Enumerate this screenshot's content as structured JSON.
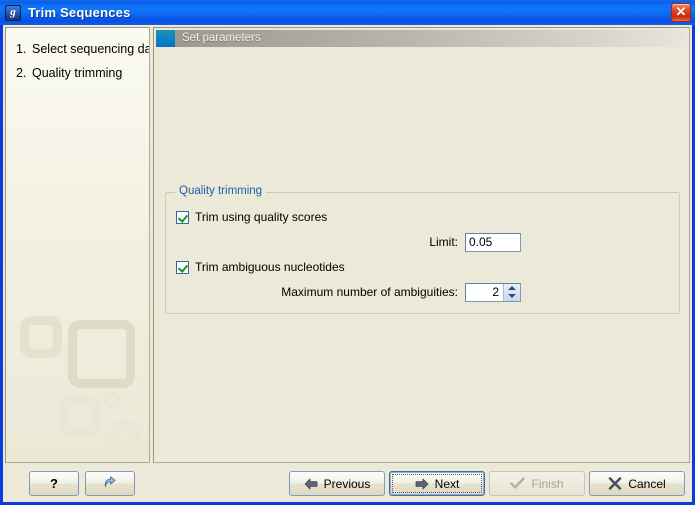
{
  "window": {
    "title": "Trim Sequences",
    "icon": "app-logo-icon",
    "close_label": "✕"
  },
  "sidebar": {
    "steps": [
      {
        "num": "1.",
        "label": "Select sequencing data"
      },
      {
        "num": "2.",
        "label": "Quality trimming"
      }
    ]
  },
  "main": {
    "header_title": "Set parameters",
    "groupbox": {
      "title": "Quality trimming",
      "trim_quality_checkbox": {
        "label": "Trim using quality scores",
        "checked": true
      },
      "limit_field": {
        "label": "Limit:",
        "value": "0.05"
      },
      "trim_ambiguous_checkbox": {
        "label": "Trim ambiguous nucleotides",
        "checked": true
      },
      "max_ambiguities": {
        "label": "Maximum number of ambiguities:",
        "value": "2"
      }
    }
  },
  "footer": {
    "help_label": "?",
    "reset_label": "",
    "previous_label": "Previous",
    "next_label": "Next",
    "finish_label": "Finish",
    "cancel_label": "Cancel"
  },
  "colors": {
    "titlebar_blue": "#0d6df4",
    "window_border": "#0a3ce0",
    "panel_bg": "#ece9d8",
    "group_title_blue": "#1861a8",
    "check_green": "#17912b",
    "close_red": "#c62d10"
  }
}
